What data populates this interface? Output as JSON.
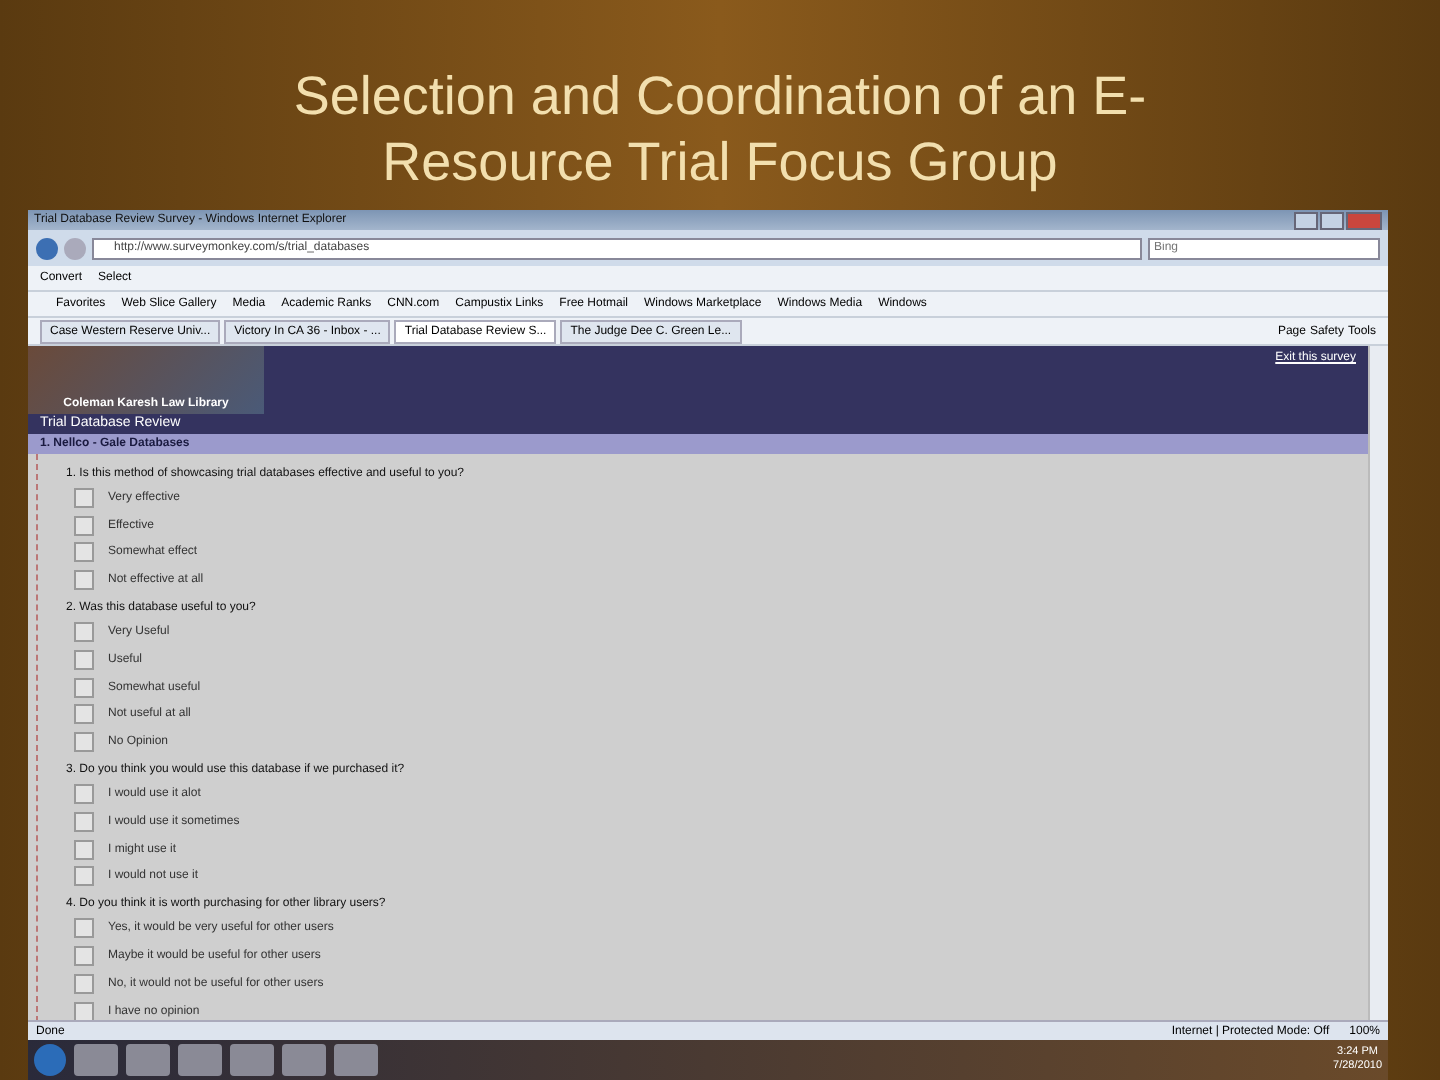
{
  "slide_title": [
    "Selection and Coordination of an E-",
    "Resource Trial Focus Group"
  ],
  "window": {
    "title": "Trial Database Review Survey - Windows Internet Explorer"
  },
  "address_bar": {
    "url": "http://www.surveymonkey.com/s/trial_databases",
    "search_placeholder": "Bing"
  },
  "command_bar": [
    "Convert",
    "Select"
  ],
  "favorites_bar": [
    "Favorites",
    "Web Slice Gallery",
    "Media",
    "Academic Ranks",
    "CNN.com",
    "Campustix Links",
    "Free Hotmail",
    "Windows Marketplace",
    "Windows Media",
    "Windows"
  ],
  "tabs": [
    {
      "label": "Case Western Reserve Univ...",
      "selected": false
    },
    {
      "label": "Victory In CA 36 - Inbox - ...",
      "selected": false
    },
    {
      "label": "Trial Database Review S...",
      "selected": true
    },
    {
      "label": "The Judge Dee C. Green Le...",
      "selected": false
    }
  ],
  "tool_menus": [
    "Page",
    "Safety",
    "Tools"
  ],
  "survey": {
    "exit_link": "Exit this survey",
    "library": "Coleman Karesh Law Library",
    "title": "Trial Database Review",
    "section": "1. Nellco - Gale Databases",
    "questions": [
      {
        "text": "1. Is this method of showcasing trial databases effective and useful to you?",
        "options": [
          {
            "label": "Very effective",
            "checked": false
          },
          {
            "label": "Effective",
            "checked": false
          },
          {
            "label": "Somewhat effect",
            "checked": false
          },
          {
            "label": "Not effective at all",
            "checked": false
          }
        ]
      },
      {
        "text": "2. Was this database useful to you?",
        "options": [
          {
            "label": "Very Useful",
            "checked": false
          },
          {
            "label": "Useful",
            "checked": false
          },
          {
            "label": "Somewhat useful",
            "checked": false
          },
          {
            "label": "Not useful at all",
            "checked": false
          },
          {
            "label": "No Opinion",
            "checked": false
          }
        ]
      },
      {
        "text": "3. Do you think you would use this database if we purchased it?",
        "options": [
          {
            "label": "I would use it alot",
            "checked": false
          },
          {
            "label": "I would use it sometimes",
            "checked": false
          },
          {
            "label": "I might use it",
            "checked": false
          },
          {
            "label": "I would not use it",
            "checked": false
          }
        ]
      },
      {
        "text": "4. Do you think it is worth purchasing for other library users?",
        "options": [
          {
            "label": "Yes, it would be very useful for other users",
            "checked": false
          },
          {
            "label": "Maybe it would be useful for other users",
            "checked": false
          },
          {
            "label": "No, it would not be useful for other users",
            "checked": false
          },
          {
            "label": "I have no opinion",
            "checked": false
          }
        ]
      }
    ]
  },
  "status_bar": {
    "text": "Done",
    "zone": "Internet | Protected Mode: Off",
    "zoom": "100%"
  },
  "taskbar": {
    "time": "3:24 PM",
    "date": "7/28/2010"
  }
}
